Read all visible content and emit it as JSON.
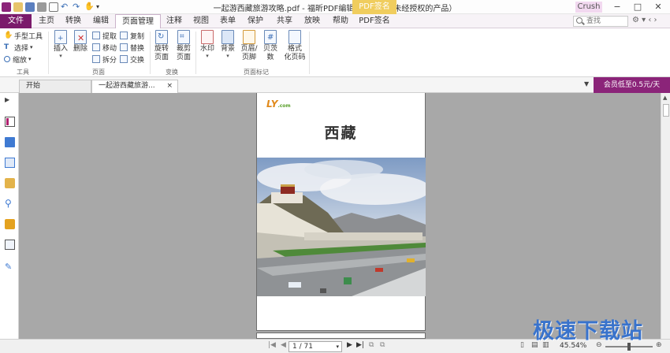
{
  "titlebar": {
    "title": "一起游西藏旅游攻略.pdf - 福昕PDF编辑器个人版（未经授权的产品）",
    "context_tab": "PDF签名",
    "user": "Crush",
    "controls": [
      "−",
      "□",
      "✕"
    ]
  },
  "menu": {
    "file": "文件",
    "tabs": [
      "主页",
      "转换",
      "编辑",
      "页面管理",
      "注释",
      "视图",
      "表单",
      "保护",
      "共享",
      "放映",
      "帮助",
      "PDF签名"
    ],
    "active_tab": "页面管理",
    "search_placeholder": "查找",
    "extras": "⚙ ▾ ‹ ›"
  },
  "ribbon": {
    "tools_group": {
      "label": "工具",
      "hand": "手型工具",
      "select": "选择",
      "zoom": "缩放"
    },
    "page_group": {
      "label": "页面",
      "insert": "插入",
      "delete": "删除",
      "extract": "提取",
      "move": "移动",
      "split": "拆分",
      "copy": "复制",
      "replace": "替换",
      "swap": "交换"
    },
    "transform_group": {
      "label": "变换",
      "rotate_1": "旋转",
      "rotate_2": "页面",
      "crop_1": "裁剪",
      "crop_2": "页面"
    },
    "marks_group": {
      "label": "页面标记",
      "watermark": "水印",
      "background": "背景",
      "header_1": "页眉/",
      "header_2": "页脚",
      "bates_1": "贝茨",
      "bates_2": "数",
      "format_1": "格式",
      "format_2": "化页码"
    }
  },
  "tabs": {
    "start": "开始",
    "doc": "一起游西藏旅游...",
    "close": "×",
    "promo": "会员低至0.5元/天"
  },
  "page": {
    "logo": "LY",
    "logo_suffix": ".com",
    "heading": "西藏"
  },
  "status": {
    "page_indicator": "1 / 71",
    "zoom": "45.54%",
    "zoom_minus": "⊖",
    "zoom_plus": "⊕"
  },
  "watermark_text": "极速下载站",
  "colors": {
    "accent": "#7b1a6b",
    "promo": "#8b2479",
    "pdf_sign_tab": "#f0cd5e",
    "doc_bg": "#a8a8a8",
    "watermark": "#2d6ed0"
  }
}
